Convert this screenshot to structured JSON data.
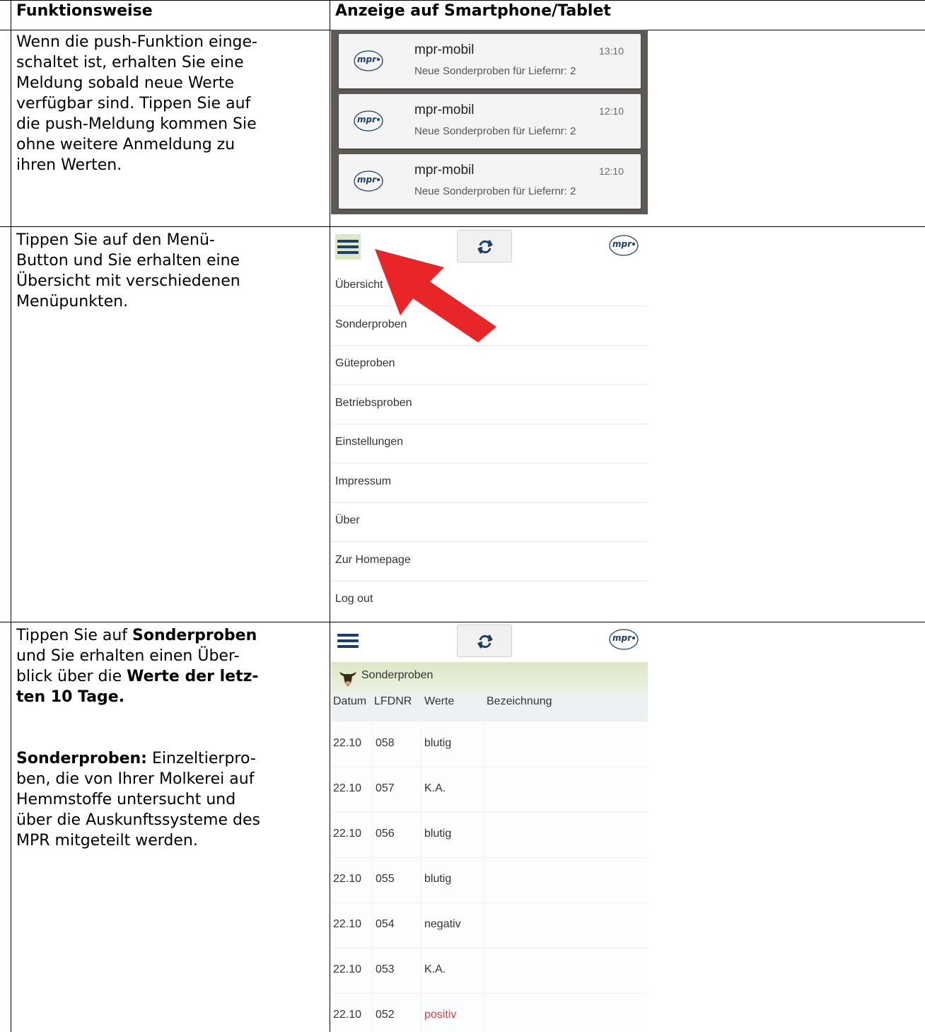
{
  "table": {
    "header_left": "Funktionsweise",
    "header_right": "Anzeige auf Smartphone/Tablet"
  },
  "row1": {
    "description": "Wenn die push-Funktion einge-\nschaltet ist, erhalten Sie eine\nMeldung sobald neue Werte\nverfügbar sind. Tippen Sie auf\ndie push-Meldung kommen Sie\nohne weitere Anmeldung zu\nihren Werten.",
    "notifications": [
      {
        "app": "mpr-mobil",
        "time": "13:10",
        "text": "Neue Sonderproben für Liefernr: 2"
      },
      {
        "app": "mpr-mobil",
        "time": "12:10",
        "text": "Neue Sonderproben für Liefernr: 2"
      },
      {
        "app": "mpr-mobil",
        "time": "12:10",
        "text": "Neue Sonderproben für Liefernr: 2"
      }
    ]
  },
  "row2": {
    "description": "Tippen Sie auf den Menü-\nButton und Sie erhalten eine\nÜbersicht mit verschiedenen\nMenüpunkten.",
    "menu_items": [
      "Übersicht",
      "Sonderproben",
      "Güteproben",
      "Betriebsproben",
      "Einstellungen",
      "Impressum",
      "Über",
      "Zur Homepage",
      "Log out"
    ]
  },
  "row3": {
    "desc_p1_a": "Tippen Sie auf ",
    "desc_p1_b": "Sonderproben",
    "desc_p1_c": "\nund Sie erhalten einen Über-\nblick über die ",
    "desc_p1_d": "Werte der letz-\nten 10 Tage.",
    "desc_p2_a": "Sonderproben:",
    "desc_p2_b": " Einzeltierpro-\nben, die von Ihrer Molkerei auf\nHemmstoffe untersucht und\nüber die Auskunftssysteme des\nMPR mitgeteilt werden.",
    "section_title": "Sonderproben",
    "columns": [
      "Datum",
      "LFDNR",
      "Werte",
      "Bezeichnung"
    ],
    "rows": [
      {
        "datum": "22.10",
        "lfdnr": "058",
        "werte": "blutig",
        "bezeichnung": ""
      },
      {
        "datum": "22.10",
        "lfdnr": "057",
        "werte": "K.A.",
        "bezeichnung": ""
      },
      {
        "datum": "22.10",
        "lfdnr": "056",
        "werte": "blutig",
        "bezeichnung": ""
      },
      {
        "datum": "22.10",
        "lfdnr": "055",
        "werte": "blutig",
        "bezeichnung": ""
      },
      {
        "datum": "22.10",
        "lfdnr": "054",
        "werte": "negativ",
        "bezeichnung": ""
      },
      {
        "datum": "22.10",
        "lfdnr": "053",
        "werte": "K.A.",
        "bezeichnung": ""
      },
      {
        "datum": "22.10",
        "lfdnr": "052",
        "werte": "positiv",
        "bezeichnung": "",
        "highlight": true
      }
    ]
  },
  "logo_text": "mpr",
  "icons": [
    "mpr-logo-icon",
    "hamburger-menu-icon",
    "refresh-icon",
    "red-arrow-icon",
    "cow-icon"
  ],
  "colors": {
    "brand_blue": "#1c3e6b",
    "arrow_red": "#e8262a",
    "positive_red": "#e53935",
    "section_green": "#dde7c6"
  }
}
